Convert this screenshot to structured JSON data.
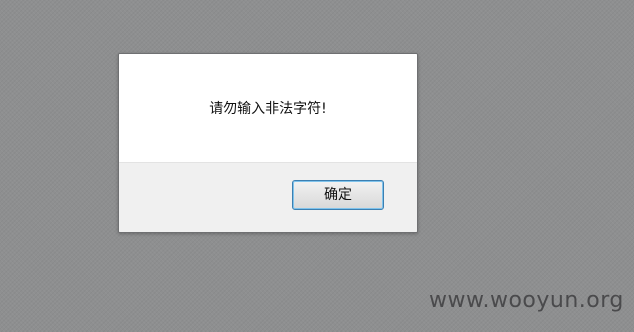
{
  "dialog": {
    "message": "请勿输入非法字符!",
    "ok_label": "确定"
  },
  "watermark": {
    "text": "www.wooyun.org"
  },
  "colors": {
    "backdrop": "#8e8f90",
    "dialog_body": "#ffffff",
    "dialog_footer": "#f0f0f0",
    "button_border": "#3c7fb1",
    "watermark": "#4a4a4c"
  }
}
